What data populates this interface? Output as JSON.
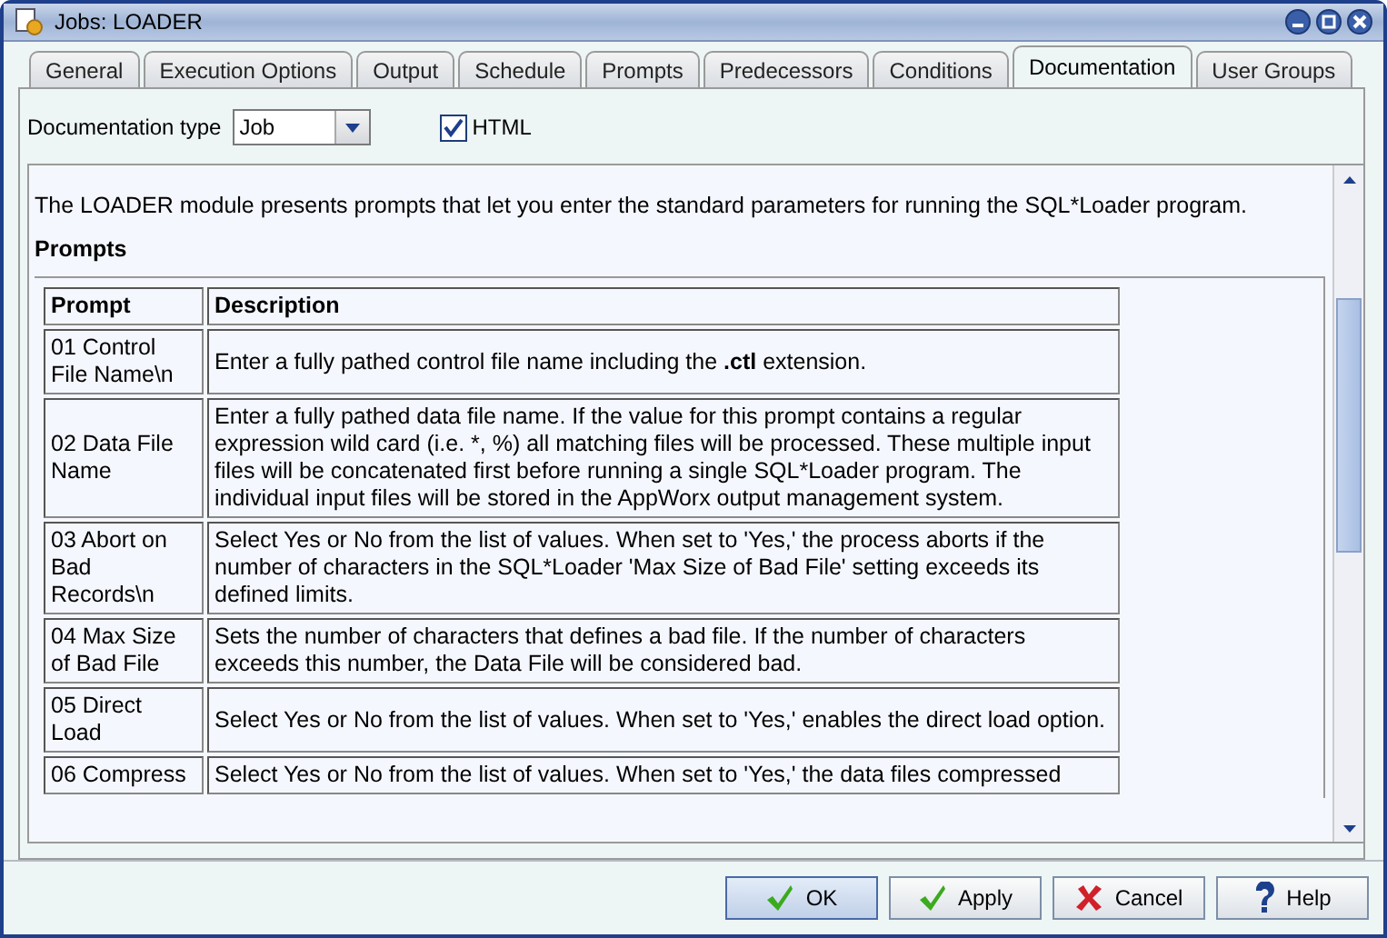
{
  "window": {
    "title": "Jobs: LOADER"
  },
  "tabs": [
    {
      "label": "General",
      "selected": false
    },
    {
      "label": "Execution Options",
      "selected": false
    },
    {
      "label": "Output",
      "selected": false
    },
    {
      "label": "Schedule",
      "selected": false
    },
    {
      "label": "Prompts",
      "selected": false
    },
    {
      "label": "Predecessors",
      "selected": false
    },
    {
      "label": "Conditions",
      "selected": false
    },
    {
      "label": "Documentation",
      "selected": true
    },
    {
      "label": "User Groups",
      "selected": false
    }
  ],
  "documentation_type": {
    "label": "Documentation type",
    "value": "Job"
  },
  "html_checkbox": {
    "label": "HTML",
    "checked": true
  },
  "document": {
    "intro": "The LOADER module presents prompts that let you enter the standard parameters for running the SQL*Loader program.",
    "heading": "Prompts",
    "table": {
      "columns": [
        "Prompt",
        "Description"
      ],
      "rows": [
        [
          "01 Control File Name\\n",
          "Enter a fully pathed control file name including the **.ctl** extension."
        ],
        [
          "02 Data File Name",
          "Enter a fully pathed data file name. If the value for this prompt contains a regular expression wild card (i.e. *, %) all matching files will be processed. These multiple input files will be concatenated first before running a single SQL*Loader program. The individual input files will be stored in the AppWorx output management system."
        ],
        [
          "03 Abort on Bad Records\\n",
          "Select Yes or No from the list of values. When set to 'Yes,' the process aborts if the number of characters in the SQL*Loader 'Max Size of Bad File' setting exceeds its defined limits."
        ],
        [
          "04 Max Size of Bad File",
          "Sets the number of characters that defines a bad file. If the number of characters exceeds this number, the Data File will be considered bad."
        ],
        [
          "05 Direct Load",
          "Select Yes or No from the list of values. When set to 'Yes,' enables the direct load option."
        ],
        [
          "06 Compress",
          "Select Yes or No from the list of values. When set to 'Yes,' the data files compressed"
        ]
      ]
    }
  },
  "buttons": [
    {
      "label": "OK",
      "kind": "ok"
    },
    {
      "label": "Apply",
      "kind": "ok"
    },
    {
      "label": "Cancel",
      "kind": "cancel"
    },
    {
      "label": "Help",
      "kind": "help"
    }
  ]
}
